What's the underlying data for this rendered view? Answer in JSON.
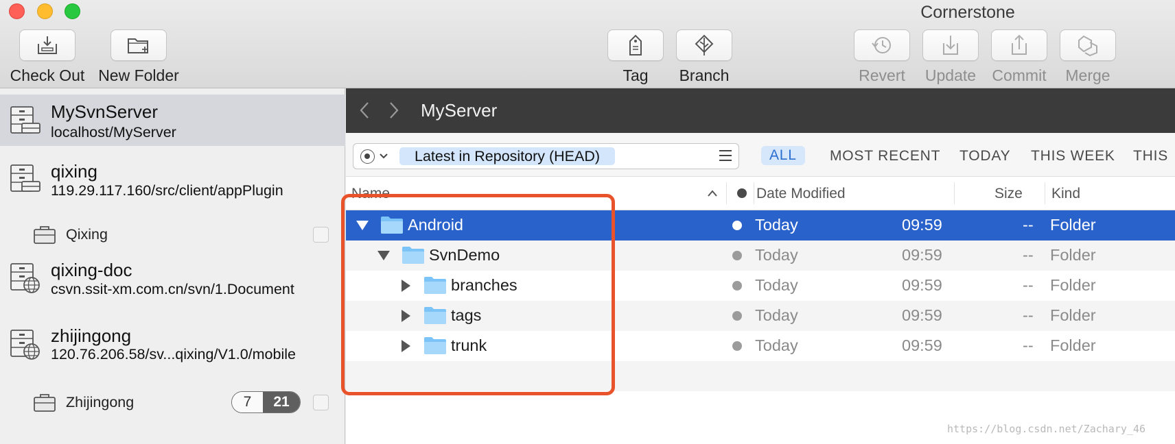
{
  "window": {
    "title": "Cornerstone"
  },
  "toolbar": {
    "checkout": "Check Out",
    "new_folder": "New Folder",
    "tag": "Tag",
    "branch": "Branch",
    "revert": "Revert",
    "update": "Update",
    "commit": "Commit",
    "merge": "Merge"
  },
  "sidebar": {
    "servers": [
      {
        "name": "MySvnServer",
        "url": "localhost/MyServer"
      },
      {
        "name": "qixing",
        "url": "119.29.117.160/src/client/appPlugin",
        "working_copy": "Qixing"
      },
      {
        "name": "qixing-doc",
        "url": "csvn.ssit-xm.com.cn/svn/1.Document"
      },
      {
        "name": "zhijingong",
        "url": "120.76.206.58/sv...qixing/V1.0/mobile",
        "working_copy": "Zhijingong",
        "badge_modified": "7",
        "badge_total": "21"
      }
    ]
  },
  "pathbar": {
    "back_icon": "chevron-left-icon",
    "forward_icon": "chevron-right-icon",
    "title": "MyServer"
  },
  "filter": {
    "revision": "Latest in Repository (HEAD)",
    "tabs": [
      "ALL",
      "MOST RECENT",
      "TODAY",
      "THIS WEEK",
      "THIS"
    ]
  },
  "columns": {
    "name": "Name",
    "date": "Date Modified",
    "size": "Size",
    "kind": "Kind"
  },
  "rows": [
    {
      "name": "Android",
      "date": "Today",
      "time": "09:59",
      "size": "--",
      "kind": "Folder"
    },
    {
      "name": "SvnDemo",
      "date": "Today",
      "time": "09:59",
      "size": "--",
      "kind": "Folder"
    },
    {
      "name": "branches",
      "date": "Today",
      "time": "09:59",
      "size": "--",
      "kind": "Folder"
    },
    {
      "name": "tags",
      "date": "Today",
      "time": "09:59",
      "size": "--",
      "kind": "Folder"
    },
    {
      "name": "trunk",
      "date": "Today",
      "time": "09:59",
      "size": "--",
      "kind": "Folder"
    }
  ],
  "colors": {
    "selection": "#2a62cc",
    "highlight_box": "#e8532c",
    "accent": "#2a6fd0"
  },
  "watermark": "https://blog.csdn.net/Zachary_46"
}
